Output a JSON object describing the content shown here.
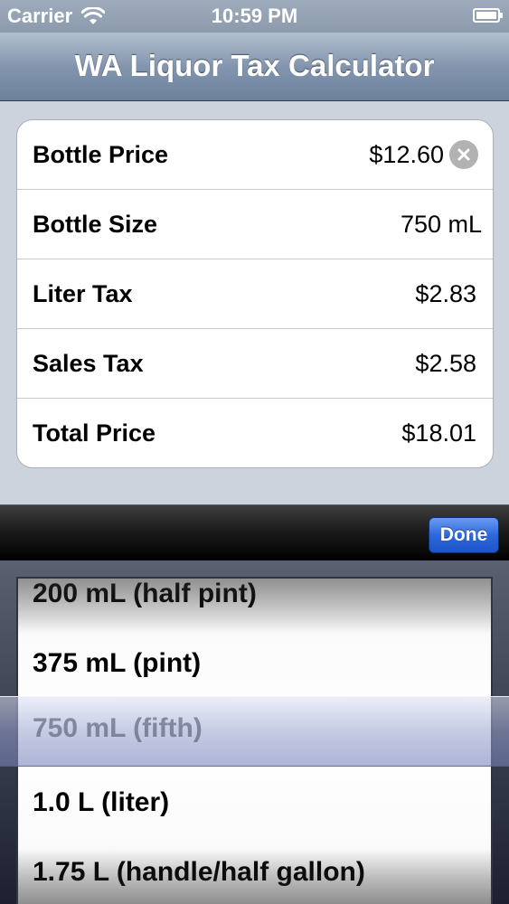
{
  "status_bar": {
    "carrier": "Carrier",
    "time": "10:59 PM"
  },
  "nav": {
    "title": "WA Liquor Tax Calculator"
  },
  "rows": [
    {
      "label": "Bottle Price",
      "value": "$12.60"
    },
    {
      "label": "Bottle Size",
      "value": "750 mL"
    },
    {
      "label": "Liter Tax",
      "value": "$2.83"
    },
    {
      "label": "Sales Tax",
      "value": "$2.58"
    },
    {
      "label": "Total Price",
      "value": "$18.01"
    }
  ],
  "toolbar": {
    "done_label": "Done"
  },
  "picker": {
    "options": [
      "200 mL (half pint)",
      "375 mL (pint)",
      "750 mL (fifth)",
      "1.0 L (liter)",
      "1.75 L (handle/half gallon)"
    ],
    "selected": "750 mL (fifth)"
  },
  "colors": {
    "done_button": "#2d68dc",
    "clear_button": "#b2b2b2"
  }
}
